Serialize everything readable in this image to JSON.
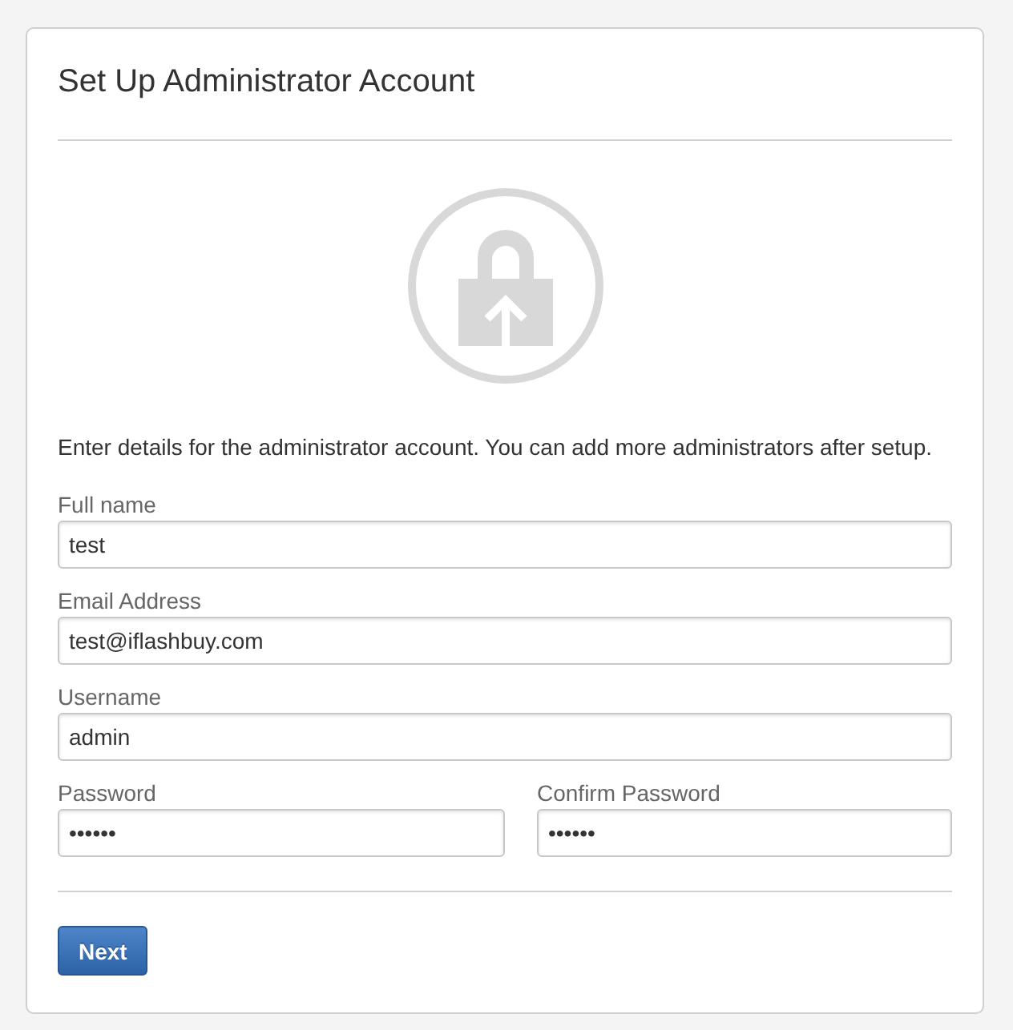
{
  "title": "Set Up Administrator Account",
  "intro": "Enter details for the administrator account. You can add more administrators after setup.",
  "fields": [
    {
      "label": "Full name",
      "value": "test"
    },
    {
      "label": "Email Address",
      "value": "test@iflashbuy.com"
    },
    {
      "label": "Username",
      "value": "admin"
    }
  ],
  "password_row": [
    {
      "label": "Password",
      "value": "••••••"
    },
    {
      "label": "Confirm Password",
      "value": "••••••"
    }
  ],
  "buttons": [
    {
      "label": "Next"
    }
  ]
}
